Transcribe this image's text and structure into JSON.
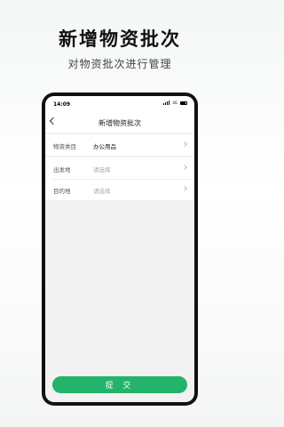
{
  "promo": {
    "title": "新增物资批次",
    "subtitle": "对物资批次进行管理"
  },
  "status_bar": {
    "time": "14:09",
    "network": "4G"
  },
  "nav": {
    "title": "新增物资批次"
  },
  "form": {
    "rows": [
      {
        "label": "物资类目",
        "value": "办公用品",
        "state": "filled"
      },
      {
        "label": "出发地",
        "value": "请选择",
        "state": "placeholder"
      },
      {
        "label": "目的地",
        "value": "请选择",
        "state": "placeholder"
      }
    ]
  },
  "submit_label": "提 交",
  "colors": {
    "accent": "#23b36b",
    "page_background": "#f2f2f2"
  },
  "icons": [
    "back-icon",
    "chevron-right-icon",
    "signal-icon",
    "battery-icon"
  ]
}
